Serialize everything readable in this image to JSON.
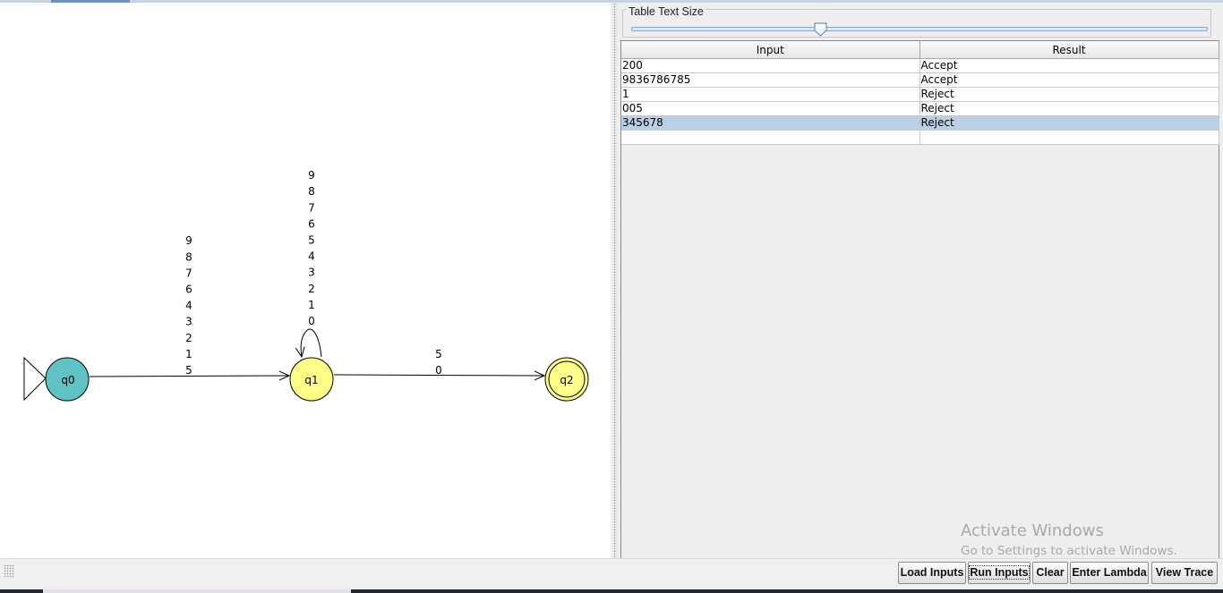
{
  "automaton": {
    "states": [
      {
        "id": "q0",
        "initial": true,
        "final": false,
        "color": "#5fc2c4"
      },
      {
        "id": "q1",
        "initial": false,
        "final": false,
        "color": "#ffff88"
      },
      {
        "id": "q2",
        "initial": false,
        "final": true,
        "color": "#ffff88"
      }
    ],
    "transitions": [
      {
        "from": "q0",
        "to": "q1",
        "labels": [
          "9",
          "8",
          "7",
          "6",
          "4",
          "3",
          "2",
          "1",
          "5"
        ]
      },
      {
        "from": "q1",
        "to": "q1",
        "labels": [
          "9",
          "8",
          "7",
          "6",
          "5",
          "4",
          "3",
          "2",
          "1",
          "0"
        ]
      },
      {
        "from": "q1",
        "to": "q2",
        "labels": [
          "5",
          "0"
        ]
      }
    ]
  },
  "slider": {
    "legend": "Table Text Size",
    "level": 0.33
  },
  "table": {
    "columns": [
      "Input",
      "Result"
    ],
    "rows": [
      {
        "input": "200",
        "result": "Accept"
      },
      {
        "input": "9836786785",
        "result": "Accept"
      },
      {
        "input": "1",
        "result": "Reject"
      },
      {
        "input": "005",
        "result": "Reject"
      },
      {
        "input": "345678",
        "result": "Reject",
        "selected": true
      },
      {
        "input": "",
        "result": ""
      }
    ]
  },
  "buttons": {
    "load_inputs": "Load Inputs",
    "run_inputs": "Run Inputs",
    "clear": "Clear",
    "enter_lambda": "Enter Lambda",
    "view_trace": "View Trace"
  },
  "watermark": {
    "title": "Activate Windows",
    "subtitle": "Go to Settings to activate Windows."
  },
  "colors": {
    "selection": "#b8cfe5",
    "accent": "#8ea7c4"
  }
}
